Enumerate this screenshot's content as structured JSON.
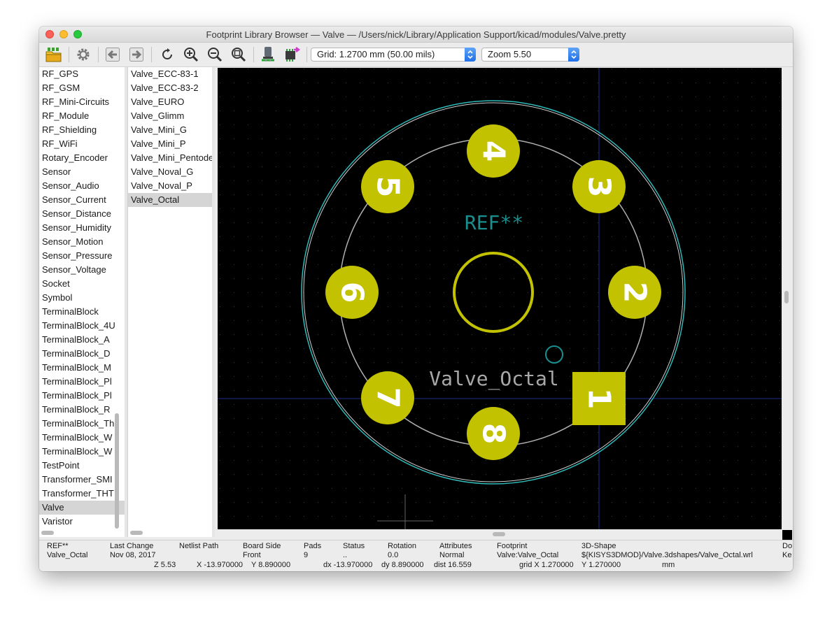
{
  "window": {
    "title": "Footprint Library Browser — Valve — /Users/nick/Library/Application Support/kicad/modules/Valve.pretty"
  },
  "toolbar": {
    "buttons": [
      "open-library-icon",
      "settings-icon",
      "previous-icon",
      "next-icon",
      "redraw-icon",
      "zoom-in-icon",
      "zoom-out-icon",
      "zoom-fit-icon",
      "3d-viewer-icon",
      "insert-footprint-icon"
    ],
    "grid_select": "Grid: 1.2700 mm (50.00 mils)",
    "zoom_select": "Zoom 5.50"
  },
  "libraries": [
    "RF_GPS",
    "RF_GSM",
    "RF_Mini-Circuits",
    "RF_Module",
    "RF_Shielding",
    "RF_WiFi",
    "Rotary_Encoder",
    "Sensor",
    "Sensor_Audio",
    "Sensor_Current",
    "Sensor_Distance",
    "Sensor_Humidity",
    "Sensor_Motion",
    "Sensor_Pressure",
    "Sensor_Voltage",
    "Socket",
    "Symbol",
    "TerminalBlock",
    "TerminalBlock_4U",
    "TerminalBlock_A",
    "TerminalBlock_D",
    "TerminalBlock_M",
    "TerminalBlock_Pl",
    "TerminalBlock_Pl",
    "TerminalBlock_R",
    "TerminalBlock_Th",
    "TerminalBlock_W",
    "TerminalBlock_W",
    "TestPoint",
    "Transformer_SMI",
    "Transformer_THT",
    "Valve",
    "Varistor"
  ],
  "selected_library": "Valve",
  "footprints": [
    "Valve_ECC-83-1",
    "Valve_ECC-83-2",
    "Valve_EURO",
    "Valve_Glimm",
    "Valve_Mini_G",
    "Valve_Mini_P",
    "Valve_Mini_Pentode",
    "Valve_Noval_G",
    "Valve_Noval_P",
    "Valve_Octal"
  ],
  "selected_footprint": "Valve_Octal",
  "canvas": {
    "ref_text": "REF**",
    "value_text": "Valve_Octal",
    "pads": [
      "1",
      "2",
      "3",
      "4",
      "5",
      "6",
      "7",
      "8"
    ],
    "colors": {
      "background": "#000000",
      "pad": "#c2c200",
      "courtyard": "#2fb8b8",
      "fab": "#b0b0b0",
      "ref": "#1a8f8f",
      "value": "#a8a8a8",
      "axis": "#1e2e8e"
    }
  },
  "status": {
    "headers": [
      "REF**",
      "Last Change",
      "Netlist Path",
      "Board Side",
      "Pads",
      "Status",
      "Rotation",
      "Attributes",
      "Footprint",
      "3D-Shape",
      "Do"
    ],
    "values": [
      "Valve_Octal",
      "Nov 08, 2017",
      "",
      "Front",
      "9",
      "..",
      "0.0",
      "Normal",
      "Valve:Valve_Octal",
      "${KISYS3DMOD}/Valve.3dshapes/Valve_Octal.wrl",
      "Ke"
    ],
    "zoom": "Z 5.53",
    "x": "X -13.970000",
    "y": "Y 8.890000",
    "dx": "dx -13.970000",
    "dy": "dy 8.890000",
    "dist": "dist 16.559",
    "grid_x": "grid X 1.270000",
    "grid_y": "Y 1.270000",
    "units": "mm"
  }
}
